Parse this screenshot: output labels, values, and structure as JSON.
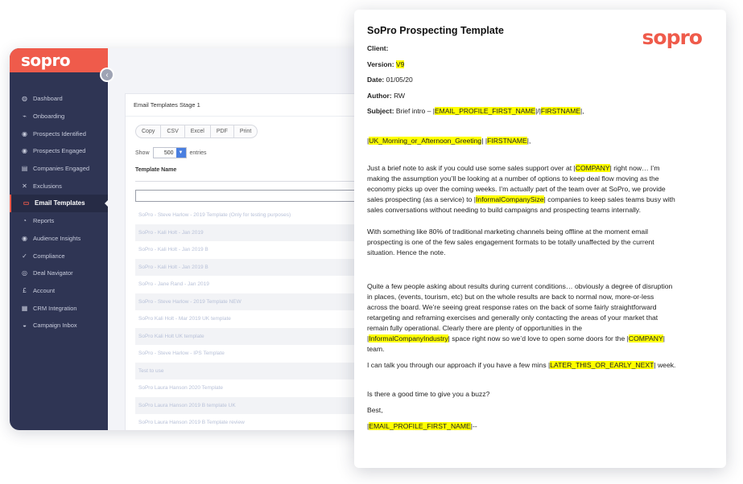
{
  "app": {
    "logo": "sopro",
    "nav": [
      {
        "icon": "dashboard-icon",
        "glyph": "◍",
        "label": "Dashboard"
      },
      {
        "icon": "onboarding-icon",
        "glyph": "⌁",
        "label": "Onboarding"
      },
      {
        "icon": "prospects-identified-icon",
        "glyph": "◉",
        "label": "Prospects Identified"
      },
      {
        "icon": "prospects-engaged-icon",
        "glyph": "◉",
        "label": "Prospects Engaged"
      },
      {
        "icon": "companies-engaged-icon",
        "glyph": "▤",
        "label": "Companies Engaged"
      },
      {
        "icon": "exclusions-icon",
        "glyph": "✕",
        "label": "Exclusions"
      },
      {
        "icon": "email-templates-icon",
        "glyph": "▭",
        "label": "Email Templates",
        "active": true
      },
      {
        "icon": "reports-icon",
        "glyph": "◔",
        "label": "Reports"
      },
      {
        "icon": "audience-insights-icon",
        "glyph": "◉",
        "label": "Audience Insights"
      },
      {
        "icon": "compliance-icon",
        "glyph": "✓",
        "label": "Compliance"
      },
      {
        "icon": "deal-navigator-icon",
        "glyph": "◎",
        "label": "Deal Navigator"
      },
      {
        "icon": "account-icon",
        "glyph": "£",
        "label": "Account"
      },
      {
        "icon": "crm-integration-icon",
        "glyph": "▦",
        "label": "CRM Integration"
      },
      {
        "icon": "campaign-inbox-icon",
        "glyph": "◒",
        "label": "Campaign Inbox"
      }
    ],
    "card": {
      "title": "Email Templates Stage 1",
      "buttons": [
        "Copy",
        "CSV",
        "Excel",
        "PDF",
        "Print"
      ],
      "show_label": "Show",
      "show_value": "500",
      "entries_label": "entries",
      "column_header": "Template Name",
      "rows": [
        "SoPro - Steve Harlow - 2019 Template (Only for testing purposes)",
        "SoPro - Kali Holt - Jan 2019",
        "SoPro - Kali Holt - Jan 2019 B",
        "SoPro - Kali Holt - Jan 2019 B",
        "SoPro - Jane Rand - Jan 2019",
        "SoPro - Steve Harlow - 2019 Template NEW",
        "SoPro Kali Holt - Mar 2019 UK template",
        "SoPro Kali Holt UK template",
        "SoPro - Steve Harlow - IPS Template",
        "Test to use",
        "SoPro Laura Hanson 2020 Template",
        "SoPro Laura Hanson 2019 B template UK",
        "SoPro Laura Hanson 2019 B Template review"
      ]
    }
  },
  "doc": {
    "title": "SoPro Prospecting Template",
    "logo": "sopro",
    "client_label": "Client:",
    "version_label": "Version:",
    "version_value": "V9",
    "date_label": "Date:",
    "date_value": "01/05/20",
    "author_label": "Author:",
    "author_value": "RW",
    "subject_label": "Subject:",
    "subject_prefix": "Brief intro – |",
    "subject_token1": "EMAIL_PROFILE_FIRST_NAME",
    "subject_mid": "|/|",
    "subject_token2": "FIRSTNAME",
    "subject_suffix": "|,",
    "greeting_pre": "|",
    "greeting_token1": "UK_Morning_or_Afternoon_Greeting",
    "greeting_mid": "| |",
    "greeting_token2": "FIRSTNAME",
    "greeting_suffix": "|,",
    "p1_a": "Just a brief note to ask if you could use some sales support over at |",
    "p1_token1": "COMPANY",
    "p1_b": "| right now…  I’m",
    "p1_line2": "making the assumption you’ll be looking at a number of options to keep deal flow moving as the",
    "p1_line3": "economy picks up over the coming weeks.  I’m actually part of the team over at SoPro, we provide",
    "p1_line4_a": "sales prospecting (as a service) to |",
    "p1_token2": "InformalCompanySize",
    "p1_line4_b": "| companies to keep sales teams busy with",
    "p1_line5": "sales conversations without needing to build campaigns and prospecting teams internally.",
    "p2_line1": "With something like 80% of traditional marketing channels being offline at the moment email",
    "p2_line2": "prospecting is one of the few sales engagement formats to be totally unaffected by the current",
    "p2_line3": "situation. Hence the note.",
    "p3_line1": "Quite a few people asking about results during current conditions…  obviously a degree of disruption",
    "p3_line2": "in places, (events, tourism, etc) but on the whole results are back to normal now, more-or-less",
    "p3_line3": "across the board.  We’re seeing great response rates on the back of some fairly straightforward",
    "p3_line4": "retargeting and reframing exercises and generally only contacting the areas of your market that",
    "p3_line5": "remain fully operational.  Clearly there are plenty of opportunities in the",
    "p3_line6_a": "|",
    "p3_token1": "InformalCompanyIndustry",
    "p3_line6_b": "| space right now so we’d love to open some doors for the |",
    "p3_token2": "COMPANY",
    "p3_line6_c": "|",
    "p3_line7": "team.",
    "p4_a": "I can talk you through our approach if you have a few mins |",
    "p4_token": "LATER_THIS_OR_EARLY_NEXT",
    "p4_b": "| week.",
    "p5": "Is there a good time to give you a buzz?",
    "p6": "Best,",
    "sig_a": "|",
    "sig_token": "EMAIL_PROFILE_FIRST_NAME",
    "sig_b": "|--"
  }
}
